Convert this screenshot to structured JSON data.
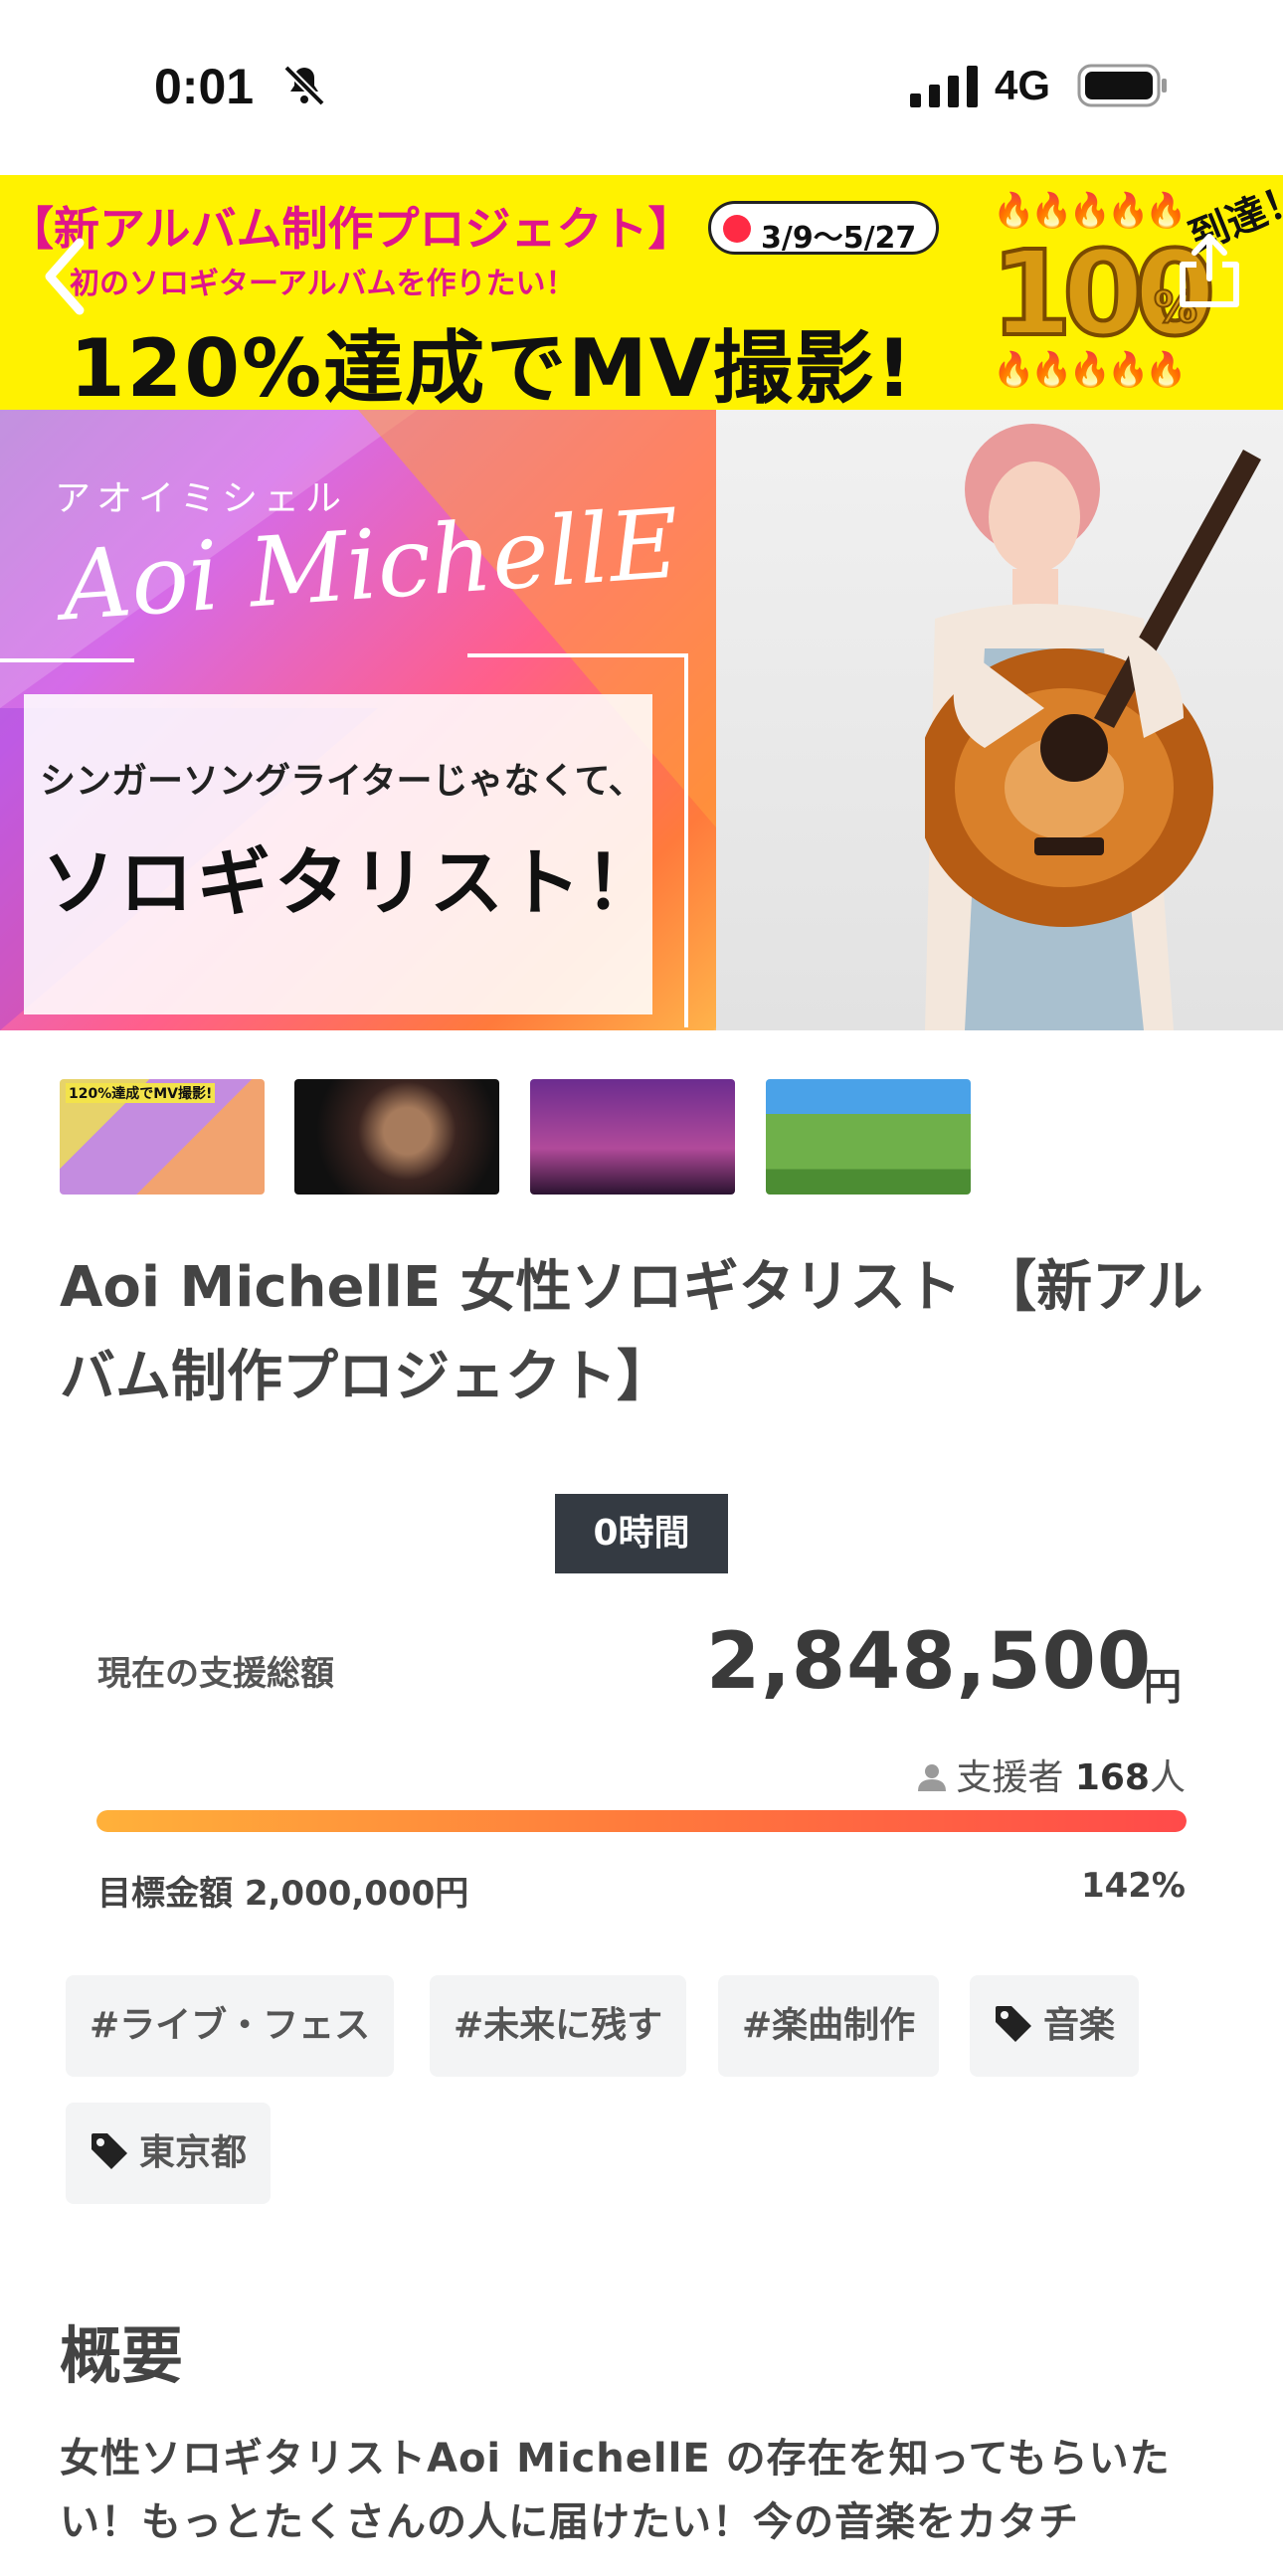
{
  "status_bar": {
    "time": "0:01",
    "network": "4G"
  },
  "hero": {
    "banner_title": "【新アルバム制作プロジェクト】",
    "date_range": "3/9〜5/27",
    "subtitle": "初のソロギターアルバムを作りたい！",
    "headline": "120%達成でMV撮影!",
    "reached_label": "到達！",
    "reached_value": "100",
    "reached_unit": "%",
    "artist_kana": "アオイミシェル",
    "artist_script": "Aoi MichellE",
    "tagline_1": "シンガーソングライターじゃなくて、",
    "tagline_2": "ソロギタリスト！"
  },
  "thumbnails": [
    {
      "caption": "120%達成でMV撮影!"
    },
    {
      "caption": ""
    },
    {
      "caption": ""
    },
    {
      "caption": ""
    }
  ],
  "project": {
    "title": "Aoi MichellE 女性ソロギタリスト 【新アルバム制作プロジェクト】",
    "time_left": "0時間",
    "total_label": "現在の支援総額",
    "total_amount": "2,848,500",
    "currency": "円",
    "supporters_label": "支援者",
    "supporters_count": "168",
    "supporters_unit": "人",
    "goal_text": "目標金額 2,000,000円",
    "percent_text": "142%",
    "progress_fraction": 1.0
  },
  "tags": [
    {
      "label": "#ライブ・フェス",
      "type": "hashtag"
    },
    {
      "label": "#未来に残す",
      "type": "hashtag"
    },
    {
      "label": "#楽曲制作",
      "type": "hashtag"
    },
    {
      "label": "音楽",
      "type": "category"
    },
    {
      "label": "東京都",
      "type": "location"
    }
  ],
  "summary": {
    "heading": "概要",
    "text": "女性ソロギタリストAoi MichellE の存在を知ってもらいたい！もっとたくさんの人に届けたい！今の音楽をカタチ"
  },
  "colors": {
    "accent_yellow": "#fff200",
    "accent_magenta": "#e0168a",
    "badge_dark": "#343a42",
    "progress_start": "#ffb13a",
    "progress_end": "#ff4a4a"
  },
  "icons": {
    "back": "chevron-left-icon",
    "share": "share-icon",
    "bell": "bell-slash-icon",
    "user": "user-icon",
    "tag": "tag-icon"
  }
}
